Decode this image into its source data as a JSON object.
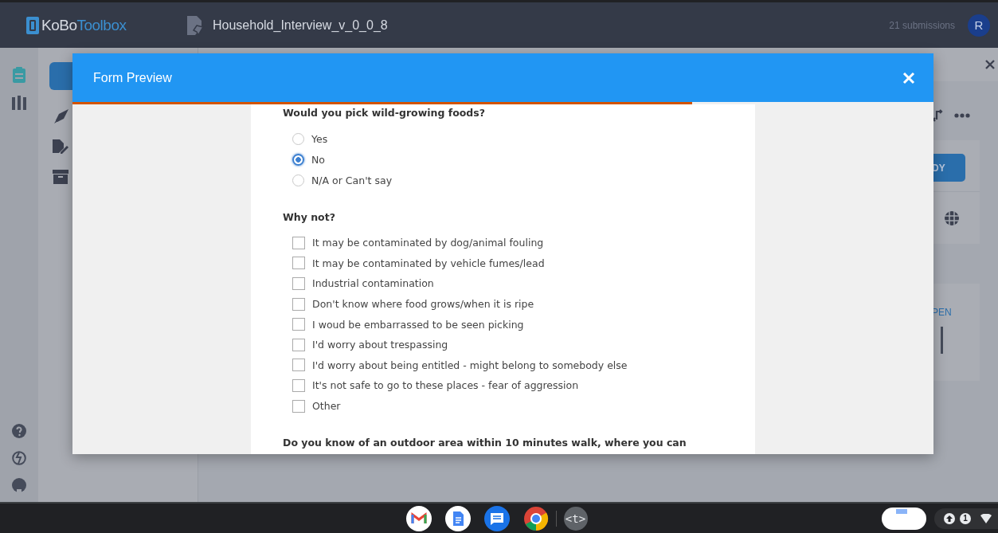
{
  "app": {
    "logo": "KoBo",
    "logo_accent": "Toolbox",
    "form_title": "Household_Interview_v_0_0_8",
    "submissions": "21 submissions",
    "avatar": "R"
  },
  "background": {
    "deploy_fragment": "DY",
    "open_fragment": "PEN"
  },
  "modal": {
    "title": "Form Preview",
    "progress": {
      "level": 0.72
    }
  },
  "questions": [
    {
      "kind": "radio",
      "label": "Would you pick wild-growing foods?",
      "options": [
        {
          "label": "Yes",
          "selected": false
        },
        {
          "label": "No",
          "selected": true
        },
        {
          "label": "N/A or Can't say",
          "selected": false
        }
      ]
    },
    {
      "kind": "checkbox",
      "label": "Why not?",
      "options": [
        {
          "label": "It may be contaminated by dog/animal fouling",
          "checked": false
        },
        {
          "label": "It may be contaminated by vehicle fumes/lead",
          "checked": false
        },
        {
          "label": "Industrial contamination",
          "checked": false
        },
        {
          "label": "Don't know where food grows/when it is ripe",
          "checked": false
        },
        {
          "label": "I woud be embarrassed to be seen picking",
          "checked": false
        },
        {
          "label": "I'd worry about trespassing",
          "checked": false
        },
        {
          "label": "I'd worry about being entitled - might belong to somebody else",
          "checked": false
        },
        {
          "label": "It's not safe to go to these places - fear of aggression",
          "checked": false
        },
        {
          "label": "Other",
          "checked": false
        }
      ]
    },
    {
      "kind": "text",
      "label": "Do you know of an outdoor area within 10 minutes walk, where you can"
    }
  ],
  "taskbar": {
    "dev_app": "<t>",
    "notifications": "1"
  }
}
